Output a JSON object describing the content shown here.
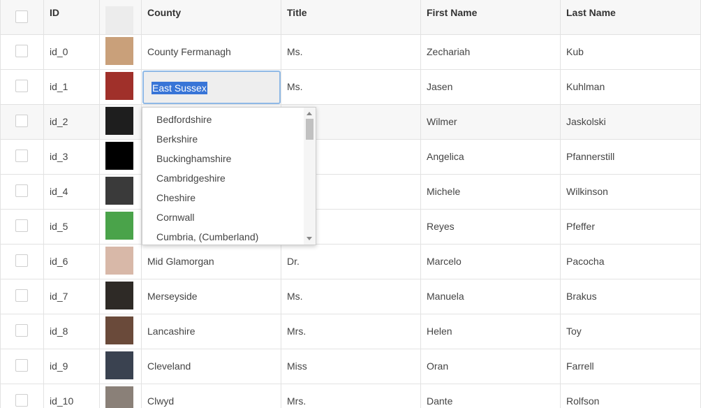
{
  "columns": {
    "id": "ID",
    "county": "County",
    "title": "Title",
    "first_name": "First Name",
    "last_name": "Last Name"
  },
  "rows": [
    {
      "id": "id_0",
      "county": "County Fermanagh",
      "title": "Ms.",
      "first": "Zechariah",
      "last": "Kub",
      "avatar_color": "#c9a07a"
    },
    {
      "id": "id_1",
      "county": "East Sussex",
      "title": "Ms.",
      "first": "Jasen",
      "last": "Kuhlman",
      "avatar_color": "#a0302a"
    },
    {
      "id": "id_2",
      "county": "",
      "title": "",
      "first": "Wilmer",
      "last": "Jaskolski",
      "avatar_color": "#1e1e1e"
    },
    {
      "id": "id_3",
      "county": "",
      "title": "",
      "first": "Angelica",
      "last": "Pfannerstill",
      "avatar_color": "#000000"
    },
    {
      "id": "id_4",
      "county": "",
      "title": "",
      "first": "Michele",
      "last": "Wilkinson",
      "avatar_color": "#3a3a3a"
    },
    {
      "id": "id_5",
      "county": "",
      "title": "",
      "first": "Reyes",
      "last": "Pfeffer",
      "avatar_color": "#4aa34a"
    },
    {
      "id": "id_6",
      "county": "Mid Glamorgan",
      "title": "Dr.",
      "first": "Marcelo",
      "last": "Pacocha",
      "avatar_color": "#d8b8a8"
    },
    {
      "id": "id_7",
      "county": "Merseyside",
      "title": "Ms.",
      "first": "Manuela",
      "last": "Brakus",
      "avatar_color": "#2e2a26"
    },
    {
      "id": "id_8",
      "county": "Lancashire",
      "title": "Mrs.",
      "first": "Helen",
      "last": "Toy",
      "avatar_color": "#6a4a3a"
    },
    {
      "id": "id_9",
      "county": "Cleveland",
      "title": "Miss",
      "first": "Oran",
      "last": "Farrell",
      "avatar_color": "#3a4250"
    },
    {
      "id": "id_10",
      "county": "Clwyd",
      "title": "Mrs.",
      "first": "Dante",
      "last": "Rolfson",
      "avatar_color": "#8a8078"
    }
  ],
  "editor": {
    "value": "East Sussex"
  },
  "dropdown": {
    "options": [
      "Bedfordshire",
      "Berkshire",
      "Buckinghamshire",
      "Cambridgeshire",
      "Cheshire",
      "Cornwall",
      "Cumbria, (Cumberland)"
    ],
    "scroll_position": 0
  },
  "colors": {
    "selection": "#3875d7",
    "editor_border": "#8fb9e6",
    "header_bg": "#f7f7f7"
  }
}
